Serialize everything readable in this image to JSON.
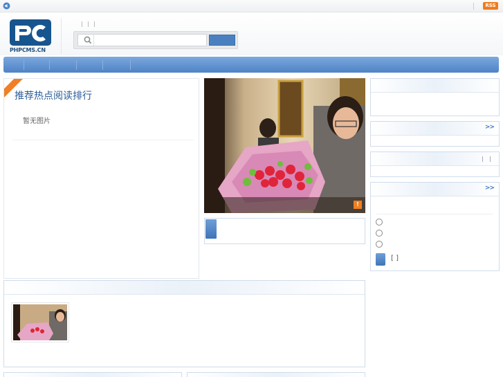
{
  "topbar": {
    "rss_label": "RSS"
  },
  "header": {
    "logo_text": "PHPCMS.CN",
    "search": {
      "placeholder": ""
    }
  },
  "hot": {
    "title": "推荐热点阅读排行",
    "no_image": "暂无图片"
  },
  "right": {
    "more_label": ">>",
    "vote": {
      "view_label": "[ ]"
    }
  },
  "icons": [
    "speaker-icon",
    "search-icon",
    "more-arrow-icon",
    "radio-icon"
  ],
  "colors": {
    "accent": "#4f83c6",
    "nav": "#6a9ad6",
    "rss": "#f07b1e",
    "title": "#2a5c98"
  }
}
